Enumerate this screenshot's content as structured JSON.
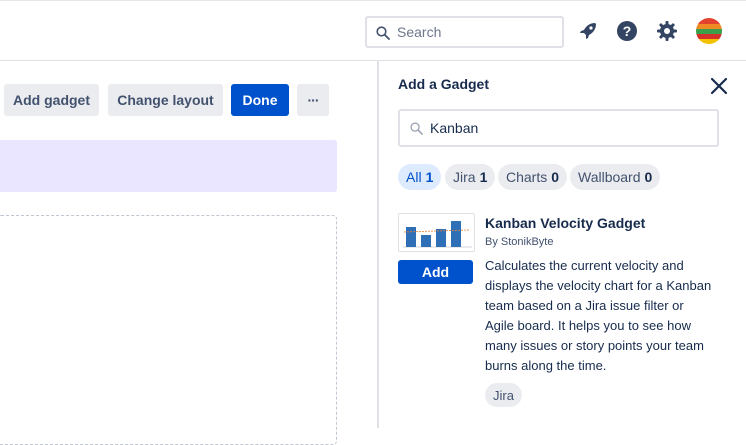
{
  "header": {
    "search_placeholder": "Search",
    "icons": [
      "search-icon",
      "rocket-icon",
      "help-icon",
      "gear-icon",
      "avatar"
    ]
  },
  "toolbar": {
    "add_gadget_label": "Add gadget",
    "change_layout_label": "Change layout",
    "done_label": "Done",
    "more_label": "···"
  },
  "panel": {
    "title": "Add a Gadget",
    "search_value": "Kanban",
    "filters": [
      {
        "label": "All",
        "count": "1",
        "active": true
      },
      {
        "label": "Jira",
        "count": "1",
        "active": false
      },
      {
        "label": "Charts",
        "count": "0",
        "active": false
      },
      {
        "label": "Wallboard",
        "count": "0",
        "active": false
      }
    ],
    "result": {
      "name": "Kanban Velocity Gadget",
      "by": "By StonikByte",
      "add_label": "Add",
      "description": "Calculates the current velocity and displays the velocity chart for a Kanban team based on a Jira issue filter or Agile board. It helps you to see how many issues or story points your team burns along the time.",
      "tag": "Jira"
    }
  },
  "colors": {
    "primary": "#0052cc",
    "chip_active_bg": "#deebff",
    "banner": "#eae6ff"
  }
}
